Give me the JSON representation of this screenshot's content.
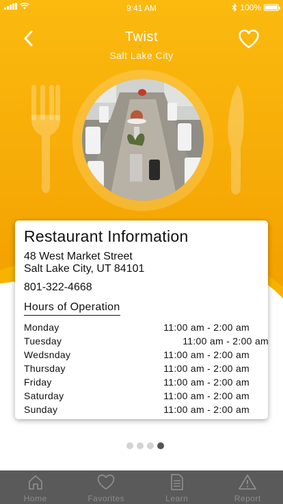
{
  "status_bar": {
    "time": "9:41 AM",
    "battery": "100%"
  },
  "header": {
    "title": "Twist",
    "subtitle": "Salt Lake City"
  },
  "colors": {
    "accent": "#F9B007",
    "accent_dark": "#F4A200",
    "tab_bar": "#5A5A5A",
    "tab_text": "#8C8C8C"
  },
  "card": {
    "title": "Restaurant Information",
    "address_line1": "48 West Market Street",
    "address_line2": "Salt Lake City, UT 84101",
    "phone": "801-322-4668",
    "hours_title": "Hours of Operation",
    "hours": [
      {
        "day": "Monday",
        "time": "11:00 am - 2:00 am"
      },
      {
        "day": "Tuesday",
        "time": "11:00 am - 2:00 am"
      },
      {
        "day": "Wedsnday",
        "time": "11:00 am - 2:00 am"
      },
      {
        "day": "Thursday",
        "time": "11:00 am - 2:00 am"
      },
      {
        "day": "Friday",
        "time": "11:00 am - 2:00 am"
      },
      {
        "day": "Saturday",
        "time": "11:00 am - 2:00 am"
      },
      {
        "day": "Sunday",
        "time": "11:00 am - 2:00 am"
      }
    ]
  },
  "pager": {
    "count": 4,
    "active_index": 3
  },
  "tabs": [
    {
      "label": "Home",
      "icon": "home-icon"
    },
    {
      "label": "Favorites",
      "icon": "heart-icon"
    },
    {
      "label": "Learn",
      "icon": "document-icon"
    },
    {
      "label": "Report",
      "icon": "warning-icon"
    }
  ]
}
